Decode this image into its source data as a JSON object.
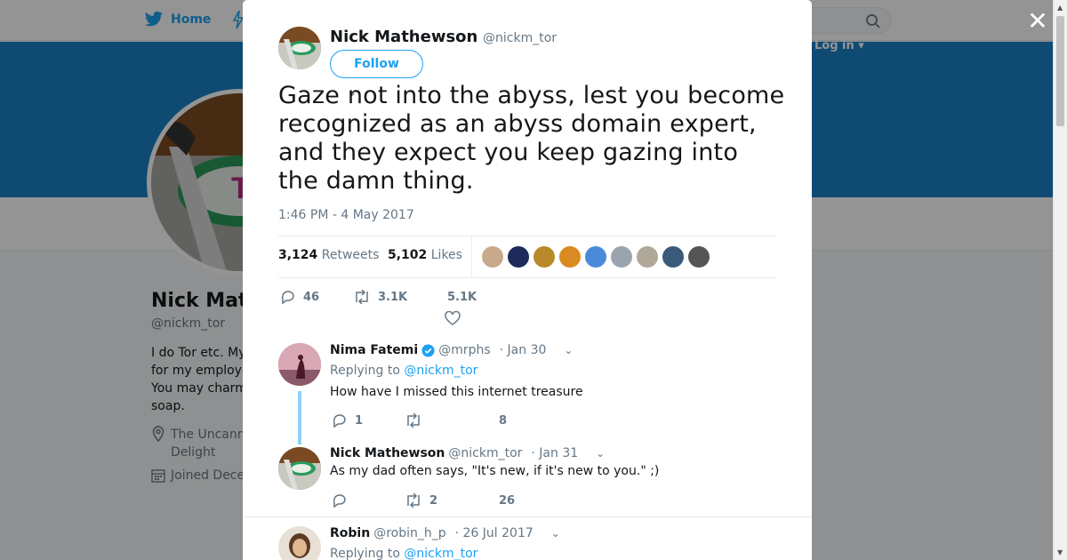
{
  "nav": {
    "home_label": "Home",
    "login_label": "Log in"
  },
  "profile_bg": {
    "name": "Nick Mat",
    "handle": "@nickm_tor",
    "bio_lines": [
      "I do Tor etc. My",
      "for my employe",
      "You may charm",
      "soap."
    ],
    "location_lines": [
      "The Uncann",
      "Delight"
    ],
    "joined": "Joined Dece"
  },
  "tweet": {
    "author_name": "Nick Mathewson",
    "author_handle": "@nickm_tor",
    "follow_label": "Follow",
    "text": "Gaze not into the abyss, lest you become recognized as an abyss domain expert, and they expect you keep gazing into the damn thing.",
    "timestamp": "1:46 PM - 4 May 2017",
    "retweets_count": "3,124",
    "retweets_label": "Retweets",
    "likes_count": "5,102",
    "likes_label": "Likes",
    "actions": {
      "replies": "46",
      "retweets": "3.1K",
      "likes": "5.1K"
    }
  },
  "liker_colors": [
    "#c8a98a",
    "#1d2a5a",
    "#b88a2a",
    "#d98a20",
    "#4a8ad8",
    "#9aa4ae",
    "#b0a898",
    "#3a5a7a",
    "#555555"
  ],
  "replies": [
    {
      "name": "Nima Fatemi",
      "verified": true,
      "handle": "@mrphs",
      "date": "· Jan 30",
      "replying_prefix": "Replying to",
      "replying_to": "@nickm_tor",
      "text": "How have I missed this internet treasure",
      "replies": "1",
      "retweets": "",
      "likes": "8"
    },
    {
      "name": "Nick Mathewson",
      "handle": "@nickm_tor",
      "date": "· Jan 31",
      "text": "As my dad often says, \"It's new, if it's new to you.\" ;)",
      "replies": "",
      "retweets": "2",
      "likes": "26"
    },
    {
      "name": "Robin",
      "handle": "@robin_h_p",
      "date": "· 26 Jul 2017",
      "replying_prefix": "Replying to",
      "replying_to": "@nickm_tor"
    }
  ],
  "colors": {
    "accent": "#1da1f2",
    "banner": "#1a80c4",
    "text": "#14171a",
    "muted": "#657786"
  }
}
